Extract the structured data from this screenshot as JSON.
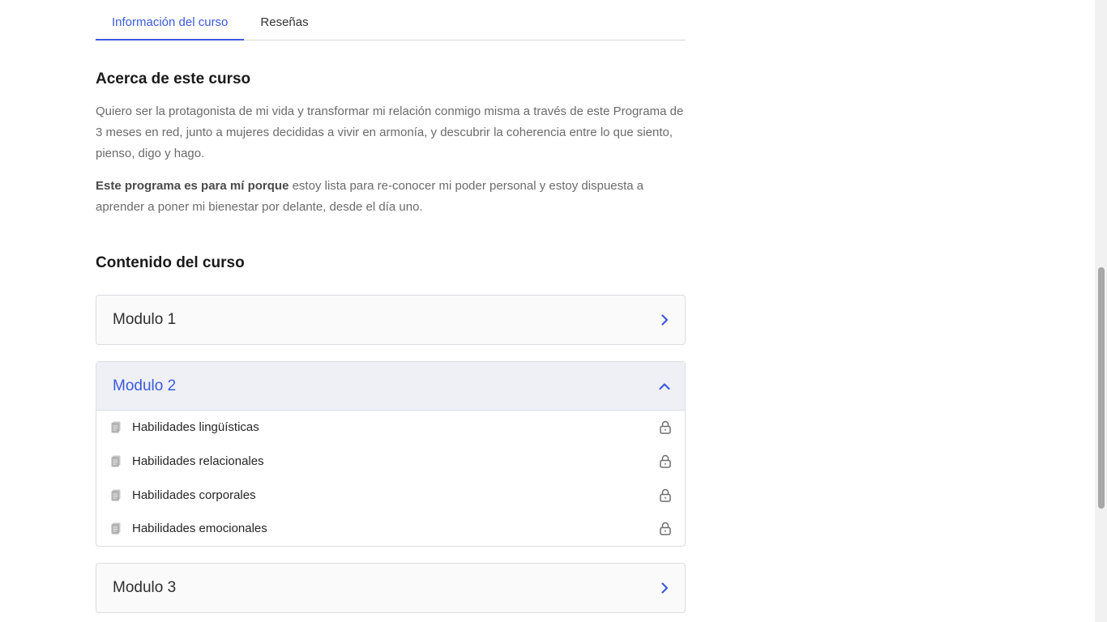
{
  "tabs": [
    {
      "label": "Información del curso",
      "active": true
    },
    {
      "label": "Reseñas",
      "active": false
    }
  ],
  "about": {
    "title": "Acerca de este curso",
    "paragraph1": "Quiero ser la protagonista de mi vida y transformar mi relación conmigo misma a través de este Programa de 3 meses en red, junto a mujeres decididas a vivir en armonía, y descubrir la coherencia entre lo que siento, pienso, digo y hago.",
    "paragraph2_bold": "Este programa es para mí porque",
    "paragraph2_rest": " estoy lista para re-conocer mi poder personal y estoy dispuesta a aprender a poner mi bienestar por delante, desde el día uno."
  },
  "course_content": {
    "title": "Contenido del curso",
    "modules": [
      {
        "name": "Modulo 1",
        "expanded": false
      },
      {
        "name": "Modulo 2",
        "expanded": true,
        "lessons": [
          {
            "label": "Habilidades lingüísticas",
            "icon": "document-icon",
            "locked": true
          },
          {
            "label": "Habilidades relacionales",
            "icon": "document-icon",
            "locked": true
          },
          {
            "label": "Habilidades corporales",
            "icon": "document-icon",
            "locked": true
          },
          {
            "label": "Habilidades emocionales",
            "icon": "document-icon",
            "locked": true
          }
        ]
      },
      {
        "name": "Modulo 3",
        "expanded": false
      }
    ]
  },
  "colors": {
    "accent": "#3b5bdb",
    "text": "#1f1f1f",
    "muted_text": "#6b6b6b",
    "border": "#dcdde2"
  }
}
